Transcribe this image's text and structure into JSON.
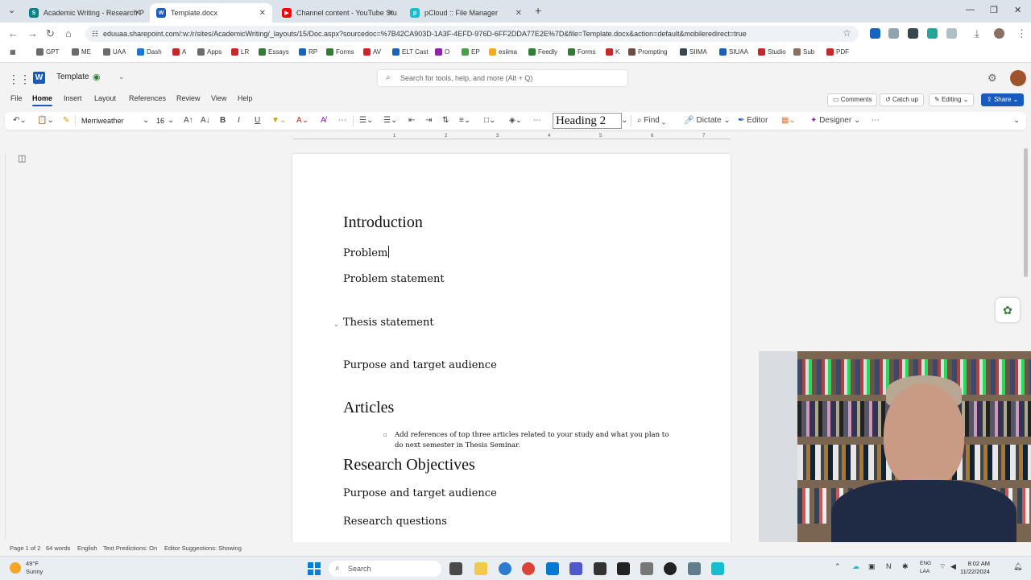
{
  "browser": {
    "tabs": [
      {
        "title": "Academic Writing - Research P",
        "icon_color": "#038387",
        "icon_text": "S"
      },
      {
        "title": "Template.docx",
        "icon_color": "#185abd",
        "icon_text": "W"
      },
      {
        "title": "Channel content - YouTube Stu",
        "icon_color": "#ff0000",
        "icon_text": "▶"
      },
      {
        "title": "pCloud :: File Manager",
        "icon_color": "#17bed0",
        "icon_text": "p"
      }
    ],
    "new_tab": "+",
    "url": "eduuaa.sharepoint.com/:w:/r/sites/AcademicWriting/_layouts/15/Doc.aspx?sourcedoc=%7B42CA903D-1A3F-4EFD-976D-6FF2DDA77E2E%7D&file=Template.docx&action=default&mobileredirect=true",
    "bookmarks": [
      {
        "label": "GPT",
        "color": "#6b6b6b"
      },
      {
        "label": "ME",
        "color": "#6b6b6b"
      },
      {
        "label": "UAA",
        "color": "#6b6b6b"
      },
      {
        "label": "Dash",
        "color": "#1976d2"
      },
      {
        "label": "A",
        "color": "#c62828"
      },
      {
        "label": "Apps",
        "color": "#6b6b6b"
      },
      {
        "label": "LR",
        "color": "#c62828"
      },
      {
        "label": "Essays",
        "color": "#2e7d32"
      },
      {
        "label": "RP",
        "color": "#1565c0"
      },
      {
        "label": "Forms",
        "color": "#2e7d32"
      },
      {
        "label": "AV",
        "color": "#c62828"
      },
      {
        "label": "ELT Cast",
        "color": "#1565c0"
      },
      {
        "label": "O",
        "color": "#8e24aa"
      },
      {
        "label": "EP",
        "color": "#43a047"
      },
      {
        "label": "esiima",
        "color": "#f9a825"
      },
      {
        "label": "Feedly",
        "color": "#2e7d32"
      },
      {
        "label": "Forms",
        "color": "#2e7d32"
      },
      {
        "label": "K",
        "color": "#c62828"
      },
      {
        "label": "Prompting",
        "color": "#6d4c41"
      },
      {
        "label": "SIIMA",
        "color": "#37474f"
      },
      {
        "label": "SIUAA",
        "color": "#1565c0"
      },
      {
        "label": "Studio",
        "color": "#c62828"
      },
      {
        "label": "Sub",
        "color": "#8d6e63"
      },
      {
        "label": "PDF",
        "color": "#c62828"
      }
    ]
  },
  "word": {
    "doc_title": "Template",
    "search_placeholder": "Search for tools, help, and more (Alt + Q)",
    "menus": [
      "File",
      "Home",
      "Insert",
      "Layout",
      "References",
      "Review",
      "View",
      "Help"
    ],
    "active_menu": "Home",
    "right_buttons": {
      "comments": "Comments",
      "catch_up": "Catch up",
      "editing": "Editing",
      "share": "Share"
    },
    "ribbon": {
      "font_name": "Merriweather",
      "font_size": "16",
      "style": "Heading 2",
      "find": "Find",
      "dictate": "Dictate",
      "editor": "Editor",
      "designer": "Designer"
    },
    "ruler_numbers": [
      "1",
      "2",
      "3",
      "4",
      "5",
      "6",
      "7"
    ]
  },
  "document": {
    "heading_intro": "Introduction",
    "line_problem": "Problem",
    "line_problem_statement": "Problem statement",
    "line_thesis": "Thesis statement",
    "line_purpose1": "Purpose and target audience",
    "heading_articles": "Articles",
    "bullet_text": "Add references of top three articles related to your study and what you plan to do next semester in Thesis Seminar.",
    "heading_objectives": "Research Objectives",
    "line_purpose2": "Purpose and target audience",
    "line_questions": "Research questions"
  },
  "status": {
    "page": "Page 1 of 2",
    "words": "64 words",
    "language": "English",
    "predictions": "Text Predictions: On",
    "editor": "Editor Suggestions: Showing"
  },
  "taskbar": {
    "weather_temp": "49°F",
    "weather_desc": "Sunny",
    "search_label": "Search",
    "lang_top": "ENG",
    "lang_bottom": "LAA",
    "time": "8:02 AM",
    "date": "11/22/2024"
  }
}
